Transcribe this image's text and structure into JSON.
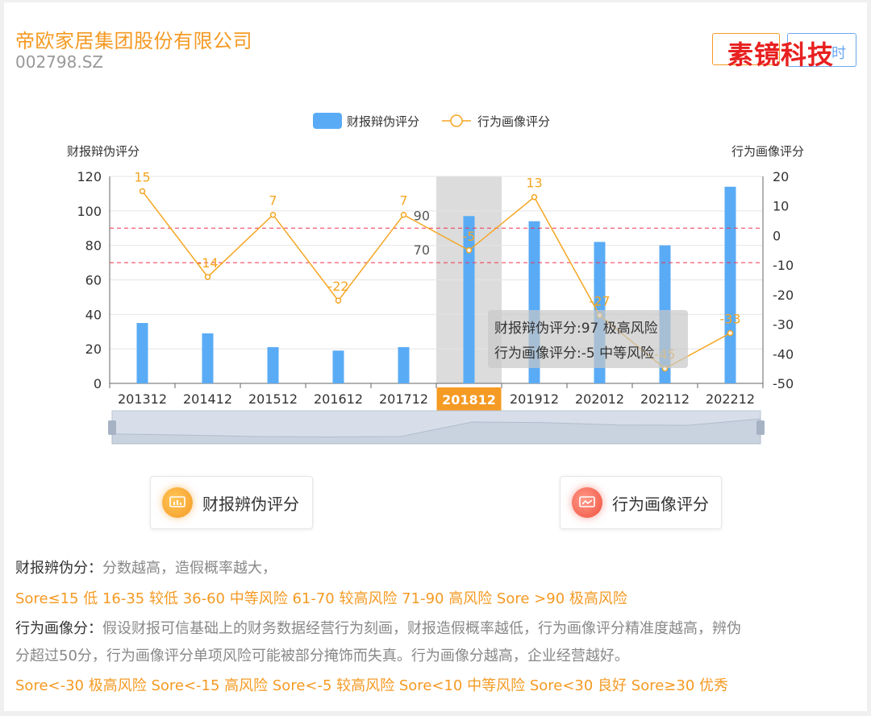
{
  "header": {
    "company_name": "帝欧家居集团股份有限公司",
    "company_code": "002798.SZ",
    "button_right_label": "时",
    "watermark": "素镜科技"
  },
  "chart_data": {
    "type": "bar+line",
    "categories": [
      "201312",
      "201412",
      "201512",
      "201612",
      "201712",
      "201812",
      "201912",
      "202012",
      "202112",
      "202212"
    ],
    "series": [
      {
        "name": "财报辩伪评分",
        "type": "bar",
        "axis": "left",
        "values": [
          35,
          29,
          21,
          19,
          21,
          97,
          94,
          82,
          80,
          114
        ],
        "color": "#5aabf5"
      },
      {
        "name": "行为画像评分",
        "type": "line",
        "axis": "right",
        "values": [
          15,
          -14,
          7,
          -22,
          7,
          -5,
          13,
          -27,
          -45,
          -33
        ],
        "color": "#f5a623"
      }
    ],
    "left_axis": {
      "label": "财报辩伪评分",
      "min": 0,
      "max": 120,
      "ticks": [
        "0",
        "20",
        "40",
        "60",
        "80",
        "100",
        "120"
      ]
    },
    "right_axis": {
      "label": "行为画像评分",
      "min": -50,
      "max": 20,
      "ticks": [
        "-50",
        "-40",
        "-30",
        "-20",
        "-10",
        "0",
        "10",
        "20"
      ]
    },
    "mark_lines": [
      {
        "value": 90,
        "label": "90"
      },
      {
        "value": 70,
        "label": "70"
      }
    ],
    "highlight_index": 5,
    "tooltip": {
      "line1": "财报辩伪评分:97 极高风险",
      "line2": "行为画像评分:-5 中等风险"
    },
    "legend": {
      "position": "top-center"
    },
    "grid": true
  },
  "buttons": {
    "fraud_score_label": "财报辨伪评分",
    "behavior_score_label": "行为画像评分"
  },
  "description": {
    "fraud_head": "财报辨伪分：",
    "fraud_body": "分数越高，造假概率越大，",
    "fraud_levels": "Sore≤15 低 16-35 较低 36-60 中等风险 61-70 较高风险 71-90 高风险 Sore >90 极高风险",
    "behavior_head": "行为画像分：",
    "behavior_body1": "假设财报可信基础上的财务数据经营行为刻画，财报造假概率越低，行为画像评分精准度越高，辨伪",
    "behavior_body2": "分超过50分，行为画像评分单项风险可能被部分掩饰而失真。行为画像分越高，企业经营越好。",
    "behavior_levels": "Sore<-30 极高风险 Sore<-15 高风险 Sore<-5 较高风险 Sore<10 中等风险 Sore<30 良好 Sore≥30 优秀"
  }
}
